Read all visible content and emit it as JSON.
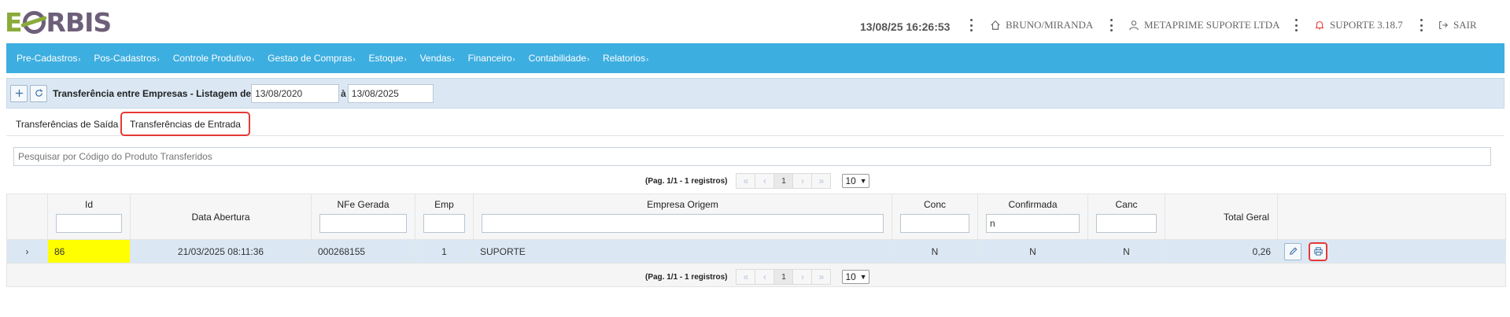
{
  "header": {
    "logo_text": "EORBIS",
    "datetime": "13/08/25 16:26:53",
    "user": "BRUNO/MIRANDA",
    "company": "METAPRIME SUPORTE LTDA",
    "version": "SUPORTE 3.18.7",
    "logout": "SAIR"
  },
  "nav": {
    "items": [
      "Pre-Cadastros",
      "Pos-Cadastros",
      "Controle Produtivo",
      "Gestao de Compras",
      "Estoque",
      "Vendas",
      "Financeiro",
      "Contabilidade",
      "Relatorios"
    ],
    "color": "#3daee0"
  },
  "toolbar": {
    "title": "Transferência entre Empresas - Listagem de",
    "date_from": "13/08/2020",
    "separator": "à",
    "date_to": "13/08/2025"
  },
  "tabs": {
    "saida": "Transferências de Saída",
    "entrada": "Transferências de Entrada"
  },
  "search": {
    "placeholder": "Pesquisar por Código do Produto Transferidos"
  },
  "pager": {
    "info": "(Pag. 1/1 - 1 registros)",
    "current_page": "1",
    "page_size": "10"
  },
  "table": {
    "columns": {
      "id": "Id",
      "data_abertura": "Data Abertura",
      "nfe": "NFe Gerada",
      "emp": "Emp",
      "empresa_origem": "Empresa Origem",
      "conc": "Conc",
      "confirmada": "Confirmada",
      "canc": "Canc",
      "total": "Total Geral"
    },
    "filters": {
      "confirmada": "n"
    },
    "rows": [
      {
        "id": "86",
        "data_abertura": "21/03/2025 08:11:36",
        "nfe": "000268155",
        "emp": "1",
        "empresa_origem": "SUPORTE",
        "conc": "N",
        "confirmada": "N",
        "canc": "N",
        "total": "0,26"
      }
    ]
  },
  "colors": {
    "highlight": "#e53935",
    "row_bg": "#dbe8f4",
    "id_bg": "#ffff00"
  }
}
